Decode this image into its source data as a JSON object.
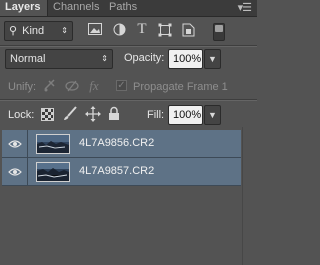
{
  "tabs": [
    {
      "label": "Layers"
    },
    {
      "label": "Channels"
    },
    {
      "label": "Paths"
    }
  ],
  "panel_menu_icon": "panel-menu-icon",
  "filter": {
    "search_icon": "search-icon",
    "kind_label": "Kind",
    "filter_icons": [
      "image-filter-icon",
      "adjustment-filter-icon",
      "type-filter-icon",
      "shape-filter-icon",
      "smart-object-filter-icon"
    ]
  },
  "blend": {
    "mode_value": "Normal",
    "opacity_label": "Opacity:",
    "opacity_value": "100%"
  },
  "unify": {
    "label": "Unify:",
    "propagate_label": "Propagate Frame 1"
  },
  "lock": {
    "label": "Lock:",
    "fill_label": "Fill:",
    "fill_value": "100%"
  },
  "layers": [
    {
      "name": "4L7A9856.CR2",
      "visible": true
    },
    {
      "name": "4L7A9857.CR2",
      "visible": true
    }
  ],
  "colors": {
    "panel_bg": "#535353",
    "selected_layer": "#5e7286"
  }
}
